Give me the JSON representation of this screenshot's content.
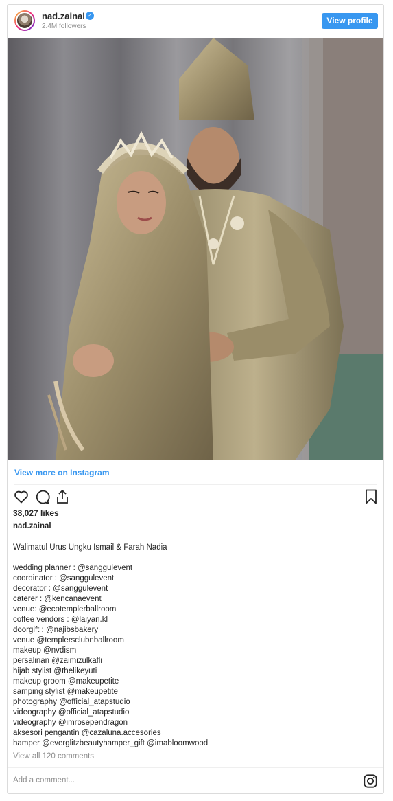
{
  "header": {
    "username": "nad.zainal",
    "followers": "2.4M followers",
    "view_profile_label": "View profile"
  },
  "post": {
    "view_more_label": "View more on Instagram",
    "likes": "38,027 likes",
    "caption_user": "nad.zainal",
    "caption_title": "Walimatul Urus Ungku Ismail & Farah Nadia",
    "caption_lines": [
      "wedding planner : @sanggulevent",
      "coordinator : @sanggulevent",
      "decorator : @sanggulevent",
      "caterer : @kencanaevent",
      "venue: @ecotemplerballroom",
      "coffee vendors : @laiyan.kl",
      "doorgift : @najibsbakery",
      "venue @templersclubnballroom",
      "makeup @nvdism",
      "persalinan @zaimizulkafli",
      "hijab stylist @thelikeyuti",
      "makeup groom @makeupetite",
      "samping stylist @makeupetite",
      "photography @official_atapstudio",
      "videography @official_atapstudio",
      "videography @imrosependragon",
      "aksesori pengantin @cazaluna.accesories",
      "hamper @everglitzbeautyhamper_gift @imabloomwood"
    ],
    "view_comments": "View all 120 comments",
    "comment_placeholder": "Add a comment..."
  },
  "icons": {
    "like": "heart-icon",
    "comment": "comment-icon",
    "share": "share-icon",
    "save": "bookmark-icon",
    "instagram": "instagram-icon",
    "verified": "verified-badge-icon"
  },
  "colors": {
    "accent": "#3897f0",
    "text": "#262626",
    "muted": "#8e8e8e",
    "border": "#dbdbdb"
  }
}
